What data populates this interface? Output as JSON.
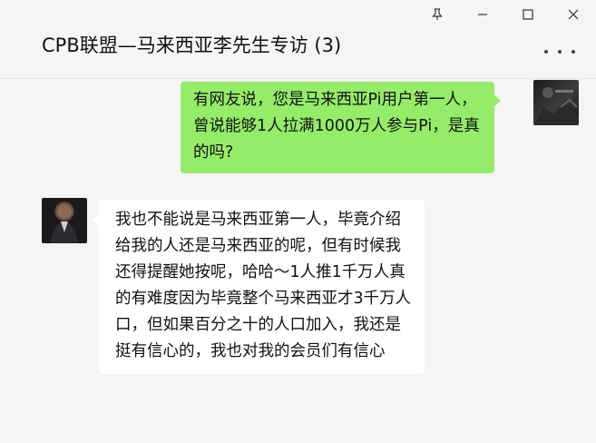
{
  "window": {
    "title": "CPB联盟—马来西亚李先生专访 (3)",
    "controls": {
      "pin_icon": "pin-icon",
      "minimize_icon": "minimize-icon",
      "maximize_icon": "maximize-icon",
      "close_icon": "close-icon"
    },
    "more_icon": "more-options-icon"
  },
  "messages": [
    {
      "direction": "outgoing",
      "text": "有网友说，您是马来西亚Pi用户第一人，曾说能够1人拉满1000万人参与Pi，是真的吗?"
    },
    {
      "direction": "incoming",
      "text": "我也不能说是马来西亚第一人，毕竟介绍给我的人还是马来西亚的呢，但有时候我还得提醒她按呢，哈哈～1人推1千万人真的有难度因为毕竟整个马来西亚才3千万人口，但如果百分之十的人口加入，我还是挺有信心的，我也对我的会员们有信心"
    }
  ],
  "colors": {
    "outgoing_bubble": "#95ec69",
    "incoming_bubble": "#ffffff",
    "background": "#f5f5f5"
  }
}
